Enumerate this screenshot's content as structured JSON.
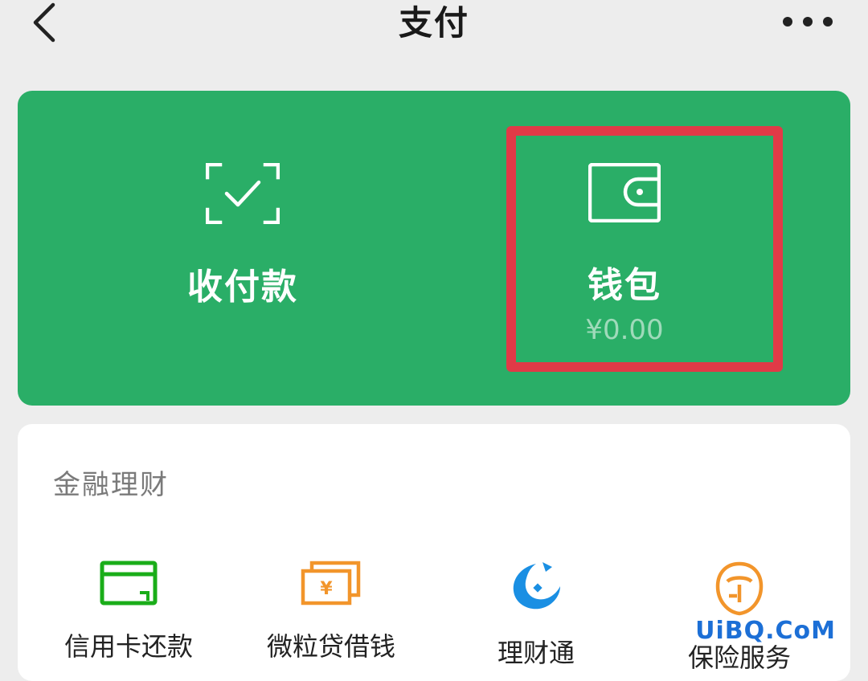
{
  "header": {
    "title": "支付"
  },
  "actions": {
    "pay": {
      "label": "收付款",
      "icon": "scan-check-icon"
    },
    "wallet": {
      "label": "钱包",
      "balance": "¥0.00",
      "icon": "wallet-icon"
    }
  },
  "finance": {
    "title": "金融理财",
    "items": [
      {
        "label": "信用卡还款",
        "icon": "credit-card-icon",
        "color": "#1aad19"
      },
      {
        "label": "微粒贷借钱",
        "icon": "loan-icon",
        "color": "#f2952b"
      },
      {
        "label": "理财通",
        "icon": "fish-icon",
        "color": "#1a8fe3"
      },
      {
        "label": "保险服务",
        "icon": "insurance-icon",
        "color": "#f2952b"
      }
    ]
  },
  "watermark": "UiBQ.CoM",
  "colors": {
    "brand_green": "#2aae67",
    "highlight_red": "#e13a47"
  }
}
